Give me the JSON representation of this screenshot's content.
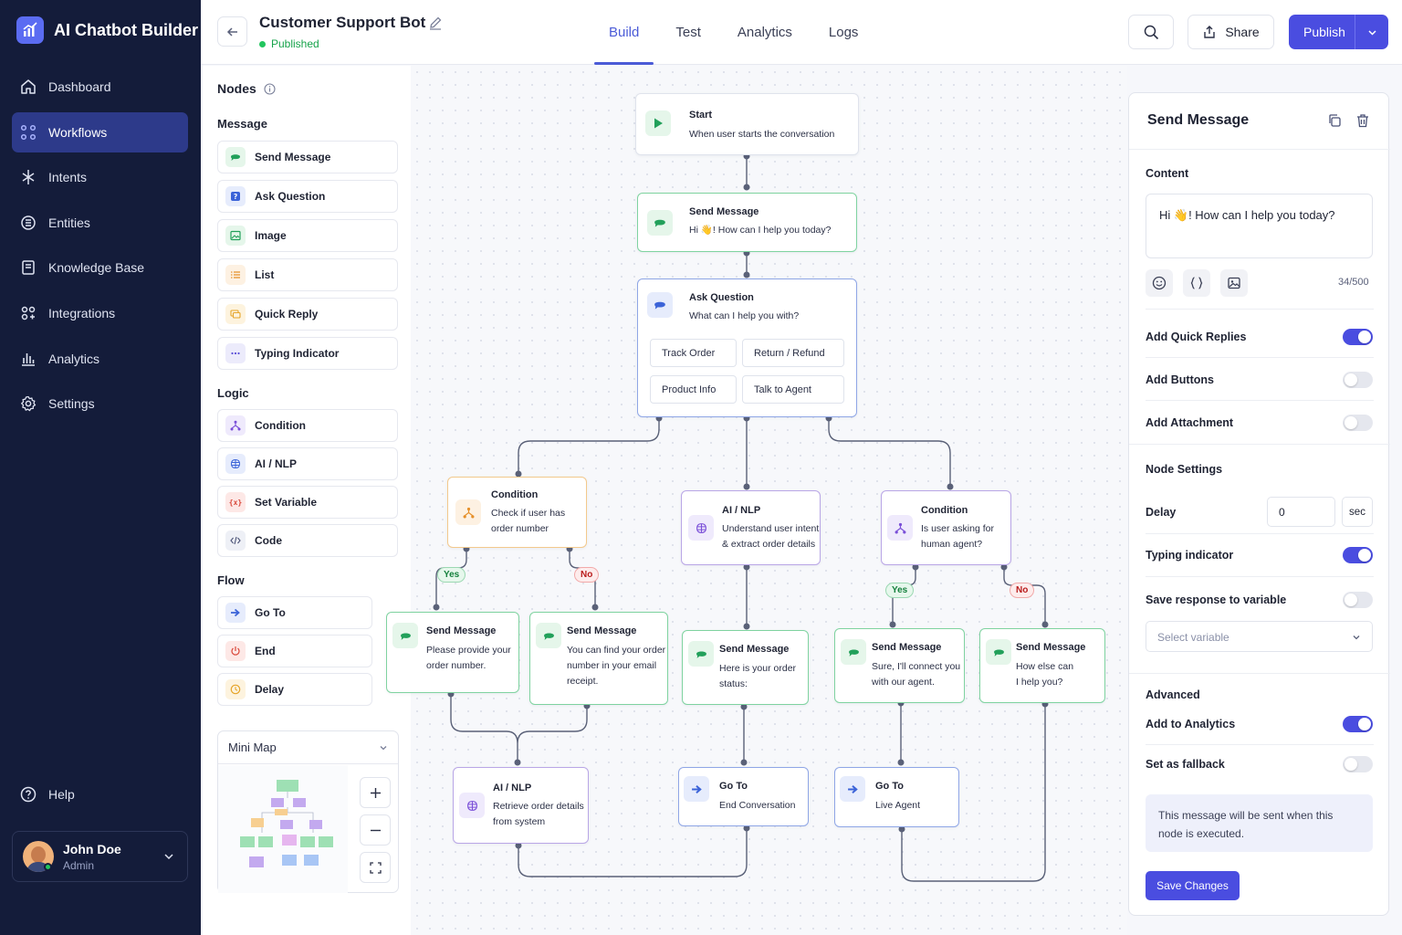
{
  "app": {
    "name": "AI Chatbot Builder"
  },
  "sidebar": {
    "items": [
      {
        "label": "Dashboard",
        "icon": "home-icon"
      },
      {
        "label": "Workflows",
        "icon": "workflow-icon",
        "active": true
      },
      {
        "label": "Intents",
        "icon": "intent-icon"
      },
      {
        "label": "Entities",
        "icon": "entity-icon"
      },
      {
        "label": "Knowledge Base",
        "icon": "book-icon"
      },
      {
        "label": "Integrations",
        "icon": "integrations-icon"
      },
      {
        "label": "Analytics",
        "icon": "bar-chart-icon"
      },
      {
        "label": "Settings",
        "icon": "gear-icon"
      }
    ],
    "help": "Help",
    "user": {
      "name": "John Doe",
      "role": "Admin"
    }
  },
  "header": {
    "title": "Customer Support Bot",
    "status": "Published",
    "tabs": [
      "Build",
      "Test",
      "Analytics",
      "Logs"
    ],
    "active_tab": "Build",
    "share": "Share",
    "publish": "Publish"
  },
  "palette": {
    "title": "Nodes",
    "sections": [
      {
        "name": "Message",
        "items": [
          "Send Message",
          "Ask Question",
          "Image",
          "List",
          "Quick Reply",
          "Typing Indicator"
        ]
      },
      {
        "name": "Logic",
        "items": [
          "Condition",
          "AI / NLP",
          "Set Variable",
          "Code"
        ]
      },
      {
        "name": "Flow",
        "items": [
          "Go To",
          "End",
          "Delay"
        ]
      }
    ],
    "minimap": "Mini Map"
  },
  "canvas": {
    "start": {
      "title": "Start",
      "desc": "When user starts the conversation"
    },
    "greet": {
      "title": "Send Message",
      "desc": "Hi 👋! How can I help you today?"
    },
    "ask": {
      "title": "Ask Question",
      "desc": "What can I help you with?",
      "options": [
        "Track Order",
        "Return / Refund",
        "Product Info",
        "Talk to Agent"
      ]
    },
    "cond1": {
      "title": "Condition",
      "desc1": "Check if user has",
      "desc2": "order number"
    },
    "nlp1": {
      "title": "AI / NLP",
      "desc1": "Understand user intent",
      "desc2": "& extract order details"
    },
    "cond2": {
      "title": "Condition",
      "desc1": "Is user asking for",
      "desc2": "human agent?"
    },
    "msg_a": {
      "title": "Send Message",
      "desc1": "Please provide your",
      "desc2": "order number."
    },
    "msg_b": {
      "title": "Send Message",
      "desc1": "You can find your order",
      "desc2": "number in your email",
      "desc3": "receipt."
    },
    "msg_c": {
      "title": "Send Message",
      "desc1": "Here is your order",
      "desc2": "status:"
    },
    "msg_d": {
      "title": "Send Message",
      "desc1": "Sure, I'll connect you",
      "desc2": "with our agent."
    },
    "msg_e": {
      "title": "Send Message",
      "desc1": "How else can",
      "desc2": "I help you?"
    },
    "nlp2": {
      "title": "AI / NLP",
      "desc1": "Retrieve order details",
      "desc2": "from system"
    },
    "goto1": {
      "title": "Go To",
      "desc": "End Conversation"
    },
    "goto2": {
      "title": "Go To",
      "desc": "Live Agent"
    },
    "yes": "Yes",
    "no": "No"
  },
  "props": {
    "title": "Send Message",
    "content_label": "Content",
    "message": "Hi 👋! How can I help you today?",
    "counter": "34/500",
    "toggles": [
      {
        "label": "Add Quick Replies",
        "on": true
      },
      {
        "label": "Add Buttons",
        "on": false
      },
      {
        "label": "Add Attachment",
        "on": false
      }
    ],
    "node_settings": "Node Settings",
    "delay_label": "Delay",
    "delay_value": "0",
    "delay_unit": "sec",
    "typing_label": "Typing indicator",
    "typing_on": true,
    "save_var_label": "Save response to variable",
    "save_var_on": false,
    "select_placeholder": "Select variable",
    "advanced": "Advanced",
    "analytics_label": "Add to Analytics",
    "analytics_on": true,
    "fallback_label": "Set as fallback",
    "fallback_on": false,
    "note": "This message will be sent when this node is executed.",
    "save": "Save Changes"
  },
  "colors": {
    "accent": "#4a4de0",
    "sidebar": "#141c3a",
    "success": "#22c55e",
    "danger": "#ef4444"
  }
}
